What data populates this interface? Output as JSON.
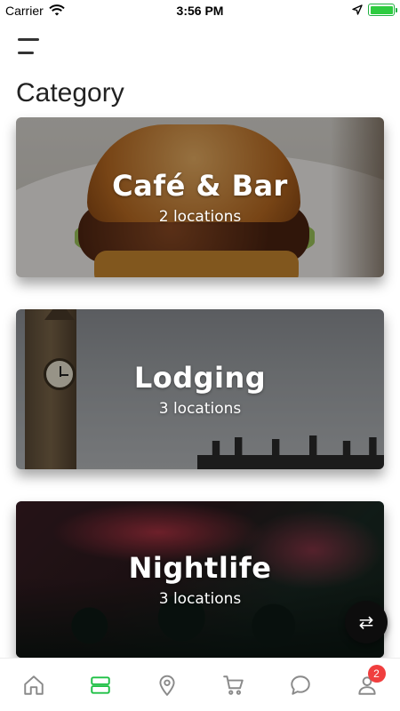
{
  "status_bar": {
    "carrier": "Carrier",
    "time": "3:56 PM",
    "battery_level": 1.0
  },
  "header": {
    "title": "Category",
    "menu_icon": "hamburger-menu-icon"
  },
  "categories": [
    {
      "title": "Café & Bar",
      "count": "2 locations"
    },
    {
      "title": "Lodging",
      "count": "3 locations"
    },
    {
      "title": "Nightlife",
      "count": "3 locations"
    }
  ],
  "fab": {
    "icon": "swap-arrows-icon",
    "glyph": "⇄"
  },
  "bottom_nav": {
    "items": [
      {
        "name": "home",
        "icon": "home-icon",
        "active": false
      },
      {
        "name": "list",
        "icon": "list-view-icon",
        "active": true
      },
      {
        "name": "location",
        "icon": "location-pin-icon",
        "active": false
      },
      {
        "name": "cart",
        "icon": "cart-icon",
        "active": false
      },
      {
        "name": "messages",
        "icon": "chat-bubble-icon",
        "active": false
      },
      {
        "name": "profile",
        "icon": "user-icon",
        "active": false,
        "badge": "2"
      }
    ],
    "active_color": "#1ec045",
    "inactive_color": "#8a8a8a"
  },
  "colors": {
    "badge": "#f03e3e",
    "battery": "#2ecc40"
  }
}
